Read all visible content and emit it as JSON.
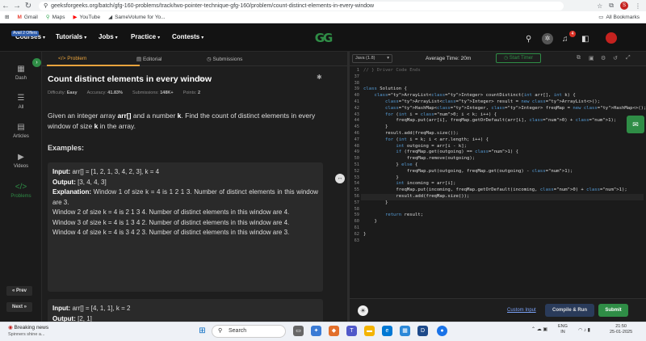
{
  "browser": {
    "url": "geeksforgeeks.org/batch/gfg-160-problems/track/two-pointer-technique-gfg-160/problem/count-distinct-elements-in-every-window",
    "bookmarks": [
      {
        "label": "Gmail",
        "icon": "gmail-icon",
        "color": "#ea4335"
      },
      {
        "label": "Maps",
        "icon": "maps-icon",
        "color": "#34a853"
      },
      {
        "label": "YouTube",
        "icon": "youtube-icon",
        "color": "#ff0000"
      },
      {
        "label": "SameVolume for Yo...",
        "icon": "samevolume-icon",
        "color": "#444444"
      }
    ],
    "all_bookmarks": "All Bookmarks",
    "profile_initial": "S"
  },
  "gfg_header": {
    "badge": "Avail 2 Offers",
    "nav": [
      "Courses",
      "Tutorials",
      "Jobs",
      "Practice",
      "Contests"
    ],
    "logo": "GG",
    "notification_count": "4"
  },
  "sidebar": {
    "items": [
      {
        "label": "Dash",
        "icon": "dashboard-icon",
        "glyph": "▦"
      },
      {
        "label": "All",
        "icon": "list-icon",
        "glyph": "☰"
      },
      {
        "label": "Articles",
        "icon": "articles-icon",
        "glyph": "▤"
      },
      {
        "label": "Videos",
        "icon": "video-icon",
        "glyph": "▶"
      },
      {
        "label": "Problems",
        "icon": "code-icon",
        "glyph": "</>"
      }
    ],
    "prev": "« Prev",
    "next": "Next »"
  },
  "problem": {
    "tabs": [
      "Problem",
      "Editorial",
      "Submissions"
    ],
    "title": "Count distinct elements in every window",
    "meta": [
      {
        "label": "Difficulty:",
        "value": "Easy"
      },
      {
        "label": "Accuracy:",
        "value": "41.83%"
      },
      {
        "label": "Submissions:",
        "value": "148K+"
      },
      {
        "label": "Points:",
        "value": "2"
      }
    ],
    "description": {
      "p1": "Given an integer array ",
      "arr": "arr[]",
      "p2": " and a number ",
      "k": "k",
      "p3": ". Find the count of distinct elements in every window of size ",
      "k2": "k",
      "p4": " in the array."
    },
    "examples_label": "Examples:",
    "example1": {
      "input_label": "Input:",
      "input": "arr[] = [1, 2, 1, 3, 4, 2, 3], k = 4",
      "output_label": "Output:",
      "output": "[3, 4, 4, 3]",
      "explanation_label": "Explanation:",
      "lines": [
        "Window 1 of size k = 4 is 1 2 1 3. Number of distinct elements in this window are 3.",
        "Window 2 of size k = 4 is 2 1 3 4. Number of distinct elements in this window are 4.",
        "Window 3 of size k = 4 is 1 3 4 2. Number of distinct elements in this window are 4.",
        "Window 4 of size k = 4 is 3 4 2 3. Number of distinct elements in this window are 3."
      ]
    },
    "example2": {
      "input_label": "Input:",
      "input": "arr[] = [4, 1, 1], k = 2",
      "output_label": "Output:",
      "output": "[2, 1]"
    }
  },
  "editor": {
    "language": "Java (1.8)",
    "avg_time": "Average Time: 20m",
    "start_timer": "Start Timer",
    "custom_input": "Custom Input",
    "compile_run": "Compile & Run",
    "submit": "Submit",
    "line_numbers": [
      "1",
      "37",
      "38",
      "39",
      "40",
      "41",
      "42",
      "43",
      "44",
      "45",
      "46",
      "47",
      "48",
      "49",
      "50",
      "51",
      "52",
      "53",
      "54",
      "55",
      "56",
      "57",
      "58",
      "59",
      "60",
      "61",
      "62",
      "63"
    ],
    "code_lines": [
      "// } Driver Code Ends",
      "",
      "",
      "class Solution {",
      "    ArrayList<Integer> countDistinct(int arr[], int k) {",
      "        ArrayList<Integer> result = new ArrayList<>();",
      "        HashMap<Integer, Integer> freqMap = new HashMap<>();",
      "        for (int i = 0; i < k; i++) {",
      "            freqMap.put(arr[i], freqMap.getOrDefault(arr[i], 0) + 1);",
      "        }",
      "        result.add(freqMap.size());",
      "        for (int i = k; i < arr.length; i++) {",
      "            int outgoing = arr[i - k];",
      "            if (freqMap.get(outgoing) == 1) {",
      "                freqMap.remove(outgoing);",
      "            } else {",
      "                freqMap.put(outgoing, freqMap.get(outgoing) - 1);",
      "            }",
      "            int incoming = arr[i];",
      "            freqMap.put(incoming, freqMap.getOrDefault(incoming, 0) + 1);",
      "            result.add(freqMap.size());",
      "        }",
      "",
      "        return result;",
      "    }",
      "",
      "}",
      ""
    ]
  },
  "taskbar": {
    "weather_title": "Breaking news",
    "weather_sub": "Spinners shine a...",
    "search": "Search",
    "lang": "ENG",
    "region": "IN",
    "time": "21:50",
    "date": "25-01-2025"
  }
}
